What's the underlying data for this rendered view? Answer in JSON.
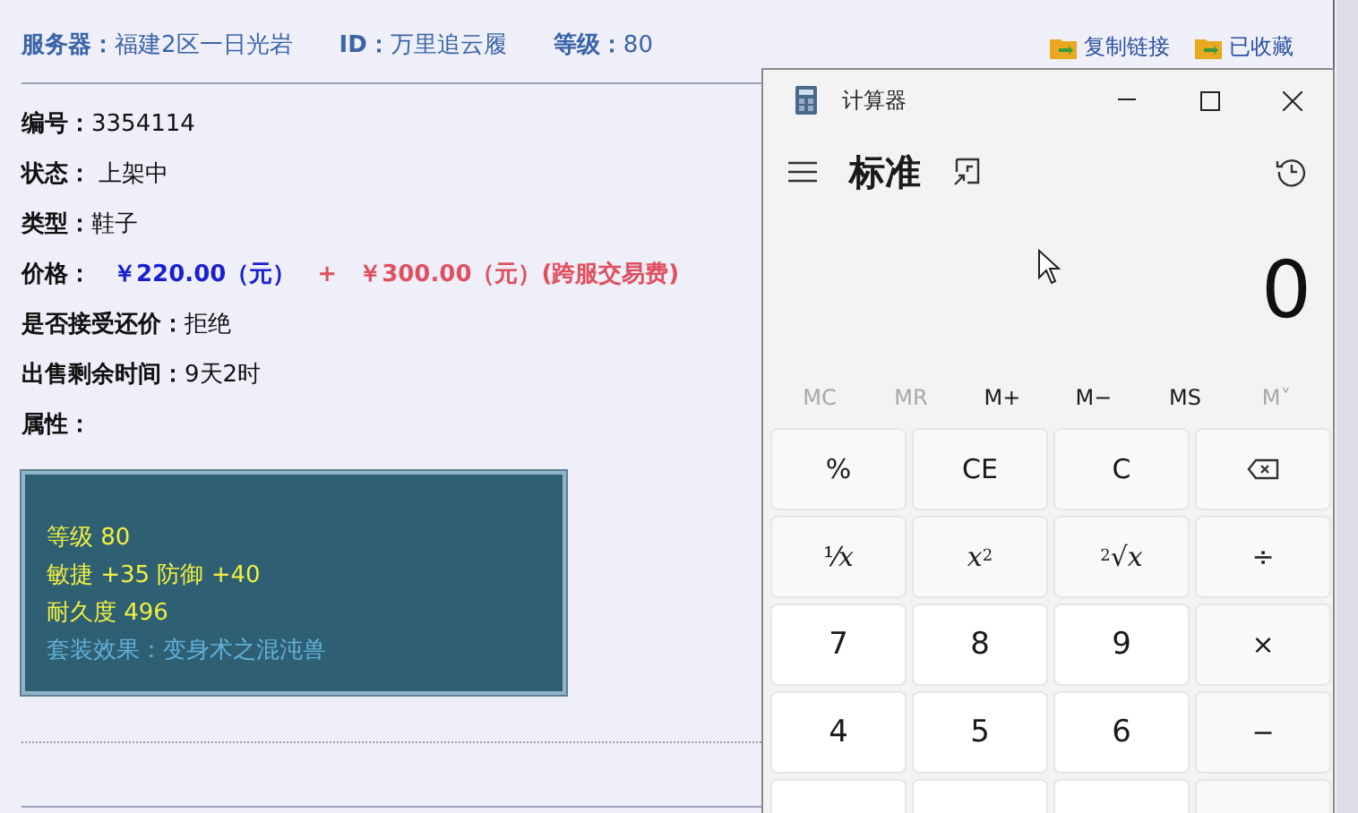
{
  "header": [
    {
      "label": "服务器：",
      "value": "福建2区一日光岩"
    },
    {
      "label": "ID：",
      "value": "万里追云履"
    },
    {
      "label": "等级：",
      "value": "80"
    }
  ],
  "links": [
    {
      "label": "复制链接"
    },
    {
      "label": "已收藏"
    }
  ],
  "fields": [
    {
      "kind": "text",
      "label": "编号：",
      "value": "3354114"
    },
    {
      "kind": "text",
      "label": "状态：",
      "value": " 上架中"
    },
    {
      "kind": "text",
      "label": "类型：",
      "value": "鞋子"
    },
    {
      "kind": "price",
      "label": "价格：",
      "price": "￥220.00（元）",
      "plus": "+",
      "fee": "￥300.00（元）(跨服交易费)"
    },
    {
      "kind": "text",
      "label": "是否接受还价：",
      "value": "拒绝"
    },
    {
      "kind": "text",
      "label": "出售剩余时间：",
      "value": "9天2时"
    },
    {
      "kind": "text",
      "label": "属性："
    }
  ],
  "attributes": [
    {
      "kind": "stat",
      "text": "等级 80"
    },
    {
      "kind": "stat",
      "text": "敏捷 +35 防御 +40"
    },
    {
      "kind": "stat",
      "text": "耐久度 496"
    },
    {
      "kind": "set",
      "text": "套装效果：变身术之混沌兽"
    }
  ],
  "calculator": {
    "title": "计算器",
    "mode": "标准",
    "display": "0",
    "memory": [
      {
        "label": "MC",
        "disabled": true
      },
      {
        "label": "MR",
        "disabled": true
      },
      {
        "label": "M+",
        "disabled": false
      },
      {
        "label": "M−",
        "disabled": false
      },
      {
        "label": "MS",
        "disabled": false
      },
      {
        "label": "M˅",
        "disabled": true
      }
    ],
    "keys": [
      {
        "kind": "function",
        "label": "%"
      },
      {
        "kind": "function",
        "label": "CE"
      },
      {
        "kind": "function",
        "label": "C"
      },
      {
        "kind": "backspace"
      },
      {
        "kind": "function",
        "label": "¹⁄*x*"
      },
      {
        "kind": "function",
        "label": "*x*$^{2}$"
      },
      {
        "kind": "function",
        "label": "$^{2}$√*x*"
      },
      {
        "kind": "function",
        "label": "÷"
      },
      {
        "kind": "digit",
        "label": "7"
      },
      {
        "kind": "digit",
        "label": "8"
      },
      {
        "kind": "digit",
        "label": "9"
      },
      {
        "kind": "function",
        "label": "×"
      },
      {
        "kind": "digit",
        "label": "4"
      },
      {
        "kind": "digit",
        "label": "5"
      },
      {
        "kind": "digit",
        "label": "6"
      },
      {
        "kind": "function",
        "label": "−"
      },
      {
        "kind": "digit"
      },
      {
        "kind": "digit"
      },
      {
        "kind": "digit"
      },
      {
        "kind": "function"
      }
    ]
  }
}
